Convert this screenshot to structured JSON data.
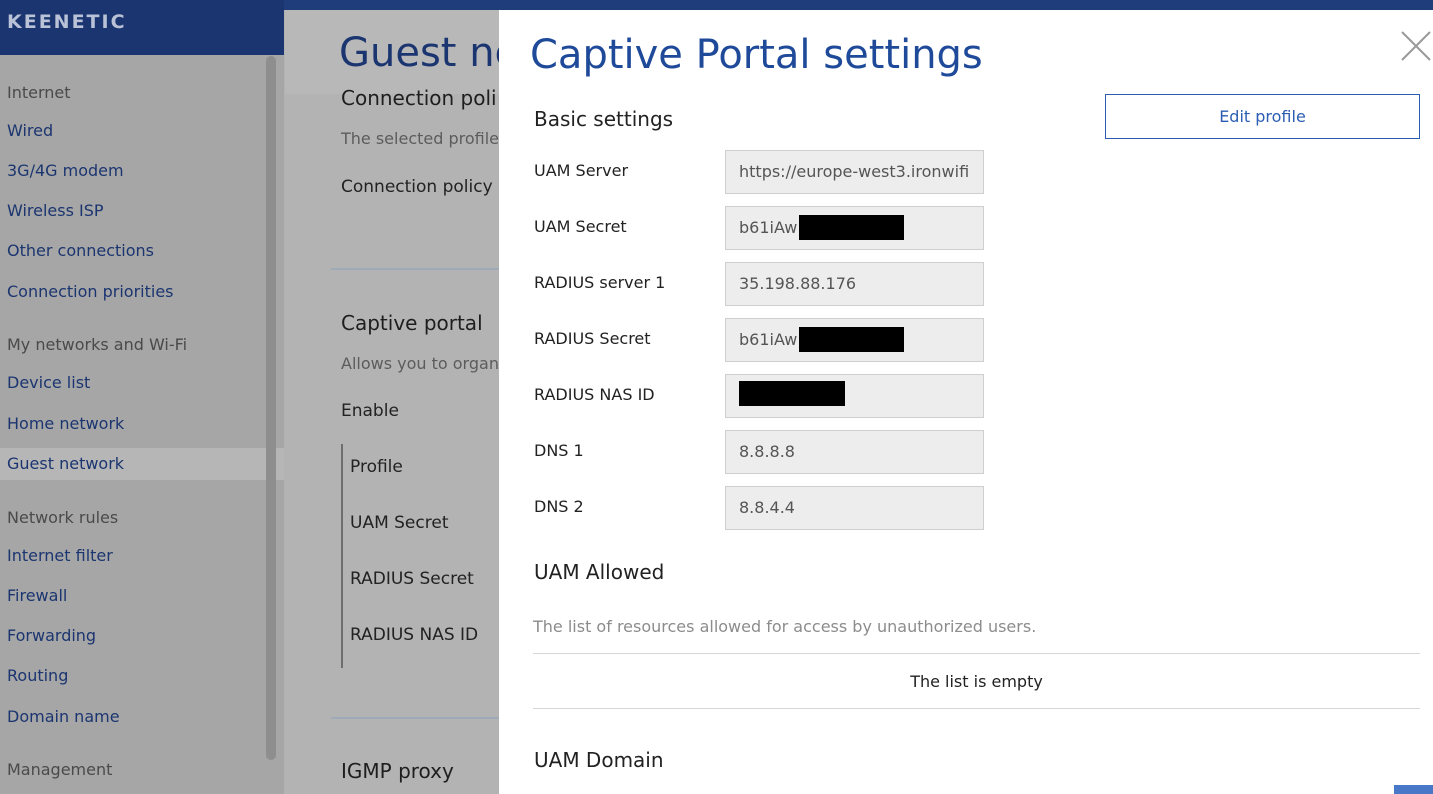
{
  "brand": {
    "logo": "KEENETIC"
  },
  "sidebar": {
    "groups": [
      {
        "title": "Internet",
        "items": [
          "Wired",
          "3G/4G modem",
          "Wireless ISP",
          "Other connections",
          "Connection priorities"
        ]
      },
      {
        "title": "My networks and Wi-Fi",
        "items": [
          "Device list",
          "Home network",
          "Guest network"
        ]
      },
      {
        "title": "Network rules",
        "items": [
          "Internet filter",
          "Firewall",
          "Forwarding",
          "Routing",
          "Domain name"
        ]
      },
      {
        "title": "Management",
        "items": []
      }
    ],
    "active_item": "Guest network"
  },
  "page": {
    "title": "Guest ne",
    "connection_policy_heading": "Connection poli",
    "connection_policy_desc": "The selected profile",
    "connection_policy_label": "Connection policy",
    "captive_portal_heading": "Captive portal",
    "captive_portal_desc": "Allows you to organ",
    "enable_label": "Enable",
    "cp_fields": [
      "Profile",
      "UAM Secret",
      "RADIUS Secret",
      "RADIUS NAS ID"
    ],
    "igmp_heading": "IGMP proxy"
  },
  "modal": {
    "title": "Captive Portal settings",
    "edit_profile_label": "Edit profile",
    "basic_settings_heading": "Basic settings",
    "fields": [
      {
        "label": "UAM Server",
        "value": "https://europe-west3.ironwifi"
      },
      {
        "label": "UAM Secret",
        "value": "b61iAw"
      },
      {
        "label": "RADIUS server 1",
        "value": "35.198.88.176"
      },
      {
        "label": "RADIUS Secret",
        "value": "b61iAw"
      },
      {
        "label": "RADIUS NAS ID",
        "value": ""
      },
      {
        "label": "DNS 1",
        "value": "8.8.8.8"
      },
      {
        "label": "DNS 2",
        "value": "8.8.4.4"
      }
    ],
    "uam_allowed_heading": "UAM Allowed",
    "uam_allowed_desc": "The list of resources allowed for access by unauthorized users.",
    "list_empty": "The list is empty",
    "uam_domain_heading": "UAM Domain"
  }
}
